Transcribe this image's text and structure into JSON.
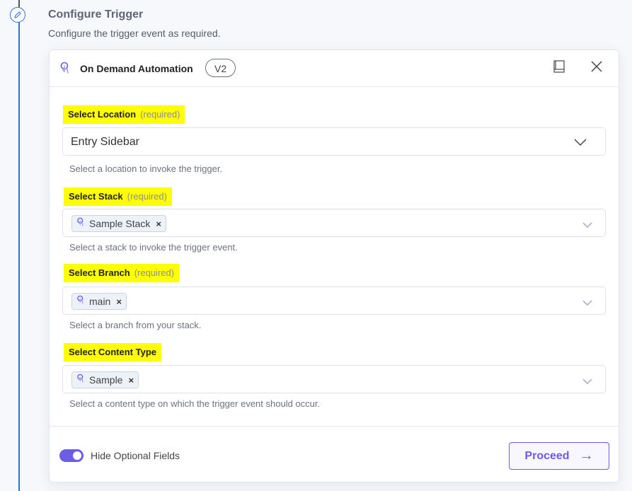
{
  "step": {
    "title": "Configure Trigger",
    "description": "Configure the trigger event as required."
  },
  "card": {
    "app_title": "On Demand Automation",
    "version": "V2",
    "icons": {
      "app": "tap-hand-icon",
      "docs": "book-icon",
      "close": "close-icon"
    }
  },
  "fields": [
    {
      "label": "Select Location",
      "required": "(required)",
      "value": "Entry Sidebar",
      "help": "Select a location to invoke the trigger."
    },
    {
      "label": "Select Stack",
      "required": "(required)",
      "chip": "Sample Stack",
      "chip_remove": "×",
      "help": "Select a stack to invoke the trigger event."
    },
    {
      "label": "Select Branch",
      "required": "(required)",
      "chip": "main",
      "chip_remove": "×",
      "help": "Select a branch from your stack."
    },
    {
      "label": "Select Content Type",
      "chip": "Sample",
      "chip_remove": "×",
      "help": "Select a content type on which the trigger event should occur."
    }
  ],
  "footer": {
    "toggle_label": "Hide Optional Fields",
    "toggle_on": true,
    "proceed_label": "Proceed",
    "proceed_arrow": "→"
  },
  "colors": {
    "accent": "#6c5ce7",
    "highlight": "#ffff00",
    "timeline": "#2f6fe0"
  }
}
